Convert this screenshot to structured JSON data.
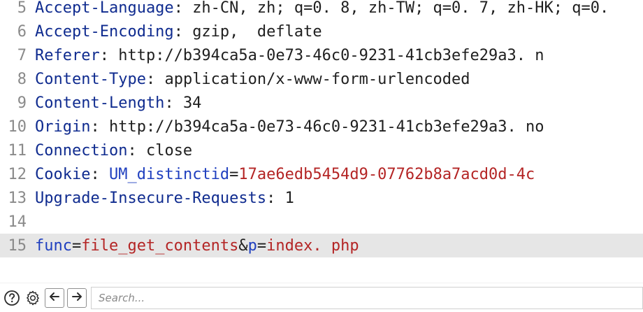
{
  "editor": {
    "lines": [
      {
        "num": "5",
        "key": "Accept-Language",
        "sep": ": ",
        "value": "zh-CN, zh; q=0. 8, zh-TW; q=0. 7, zh-HK; q=0."
      },
      {
        "num": "6",
        "key": "Accept-Encoding",
        "sep": ": ",
        "value": "gzip,  deflate"
      },
      {
        "num": "7",
        "key": "Referer",
        "sep": ": ",
        "value": "http://b394ca5a-0e73-46c0-9231-41cb3efe29a3. n"
      },
      {
        "num": "8",
        "key": "Content-Type",
        "sep": ": ",
        "value": "application/x-www-form-urlencoded"
      },
      {
        "num": "9",
        "key": "Content-Length",
        "sep": ": ",
        "value": "34"
      },
      {
        "num": "10",
        "key": "Origin",
        "sep": ": ",
        "value": "http://b394ca5a-0e73-46c0-9231-41cb3efe29a3. no"
      },
      {
        "num": "11",
        "key": "Connection",
        "sep": ": ",
        "value": "close"
      },
      {
        "num": "12",
        "key": "Cookie",
        "sep": ": ",
        "cookie_name": "UM_distinctid",
        "eq": "=",
        "cookie_value": "17ae6edb5454d9-07762b8a7acd0d-4c"
      },
      {
        "num": "13",
        "key": "Upgrade-Insecure-Requests",
        "sep": ": ",
        "value": "1"
      },
      {
        "num": "14"
      },
      {
        "num": "15",
        "param1": "func",
        "eq1": "=",
        "value1": "file_get_contents",
        "amp": "&",
        "param2": "p",
        "eq2": "=",
        "value2": "index. php"
      }
    ]
  },
  "toolbar": {
    "help_icon": "question-circle-icon",
    "settings_icon": "gear-icon",
    "back_icon": "arrow-left-icon",
    "forward_icon": "arrow-right-icon",
    "search_placeholder": "Search..."
  },
  "colors": {
    "key": "#0f2b8f",
    "value_red": "#b42525",
    "param_blue": "#1f3fbf",
    "highlight": "#e6e6e6",
    "gutter": "#8a8a8a"
  }
}
